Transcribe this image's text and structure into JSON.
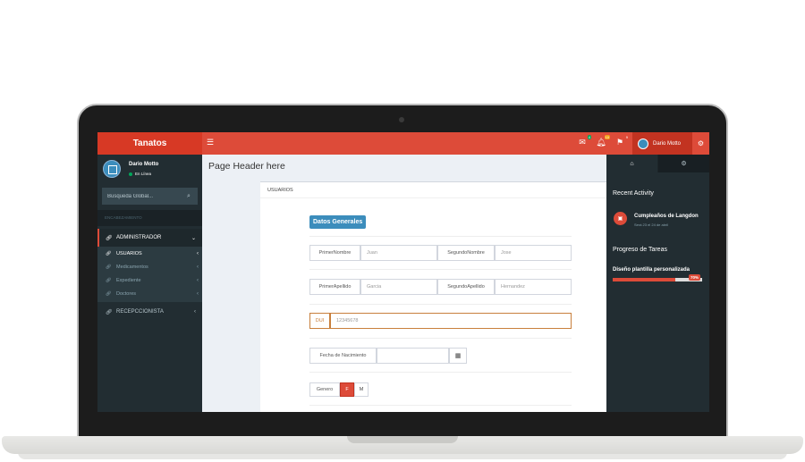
{
  "header": {
    "brand": "Tanatos",
    "menu_icon": "hamburger-icon",
    "mail_badge": "4",
    "bell_badge": "10",
    "flag_badge": "9",
    "user_name": "Dario Motto",
    "settings_icon": "gears-icon"
  },
  "sidebar": {
    "user_name": "Dario Motto",
    "user_status": "En Línea",
    "search_placeholder": "Busqueda Global...",
    "section_header": "ENCABEZAMIENTO",
    "items": [
      {
        "label": "ADMINISTRADOR",
        "icon": "link-icon",
        "expanded": true
      },
      {
        "label": "RECEPCCIONISTA",
        "icon": "link-icon",
        "expanded": false
      }
    ],
    "subitems": [
      {
        "label": "USUARIOS",
        "icon": "link-icon"
      },
      {
        "label": "Medicamentos",
        "icon": "link-icon"
      },
      {
        "label": "Expediente",
        "icon": "link-icon"
      },
      {
        "label": "Doctores",
        "icon": "link-icon"
      }
    ]
  },
  "content": {
    "page_header": "Page Header here",
    "box_title": "USUARIOS",
    "section_title": "Datos Generales",
    "fields": {
      "primer_nombre_label": "PrimerNombre",
      "primer_nombre_value": "Juan",
      "segundo_nombre_label": "SegundoNombre",
      "segundo_nombre_value": "Jose",
      "primer_apellido_label": "PrimerApellido",
      "primer_apellido_value": "Garcia",
      "segundo_apellido_label": "SegundoApellido",
      "segundo_apellido_value": "Hernandez",
      "dui_label": "DUI",
      "dui_value": "12345678",
      "fecha_label": "Fecha de Nacimiento",
      "fecha_value": "",
      "genero_label": "Genero",
      "genero_options": [
        "F",
        "M"
      ],
      "genero_selected": "F"
    }
  },
  "control_sidebar": {
    "tabs": [
      {
        "icon": "home-icon"
      },
      {
        "icon": "gears-icon"
      }
    ],
    "recent_activity_title": "Recent Activity",
    "activity_title": "Cumpleaños de Langdon",
    "activity_subtitle": "Será 23 el 24 de abril",
    "tasks_title": "Progreso de Tareas",
    "task_label": "Diseño plantilla personalizada",
    "task_progress": 70,
    "task_progress_label": "70%"
  },
  "colors": {
    "header_red": "#dd4b39",
    "sidebar_dark": "#222d32",
    "accent_blue": "#3c8dbc"
  }
}
